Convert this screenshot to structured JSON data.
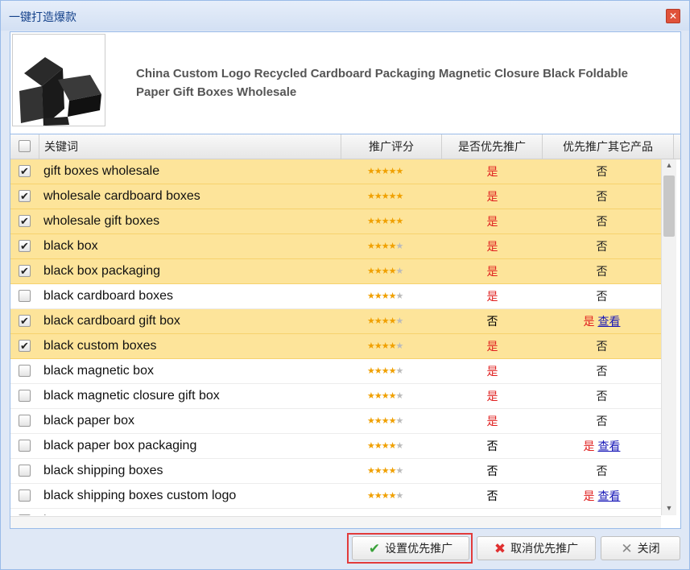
{
  "window": {
    "title": "一键打造爆款",
    "close_icon": "close-icon"
  },
  "product": {
    "title": "China Custom Logo Recycled Cardboard Packaging Magnetic Closure Black Foldable Paper Gift Boxes Wholesale"
  },
  "table": {
    "headers": {
      "keyword": "关键词",
      "rating": "推广评分",
      "priority": "是否优先推广",
      "other": "优先推广其它产品"
    },
    "rows": [
      {
        "keyword": "gift boxes wholesale",
        "checked": true,
        "rating": 5,
        "priority": "是",
        "other": "否",
        "other_link": ""
      },
      {
        "keyword": "wholesale cardboard boxes",
        "checked": true,
        "rating": 5,
        "priority": "是",
        "other": "否",
        "other_link": ""
      },
      {
        "keyword": "wholesale gift boxes",
        "checked": true,
        "rating": 5,
        "priority": "是",
        "other": "否",
        "other_link": ""
      },
      {
        "keyword": "black box",
        "checked": true,
        "rating": 4,
        "priority": "是",
        "other": "否",
        "other_link": ""
      },
      {
        "keyword": "black box packaging",
        "checked": true,
        "rating": 4,
        "priority": "是",
        "other": "否",
        "other_link": ""
      },
      {
        "keyword": "black cardboard boxes",
        "checked": false,
        "rating": 4,
        "priority": "是",
        "other": "否",
        "other_link": ""
      },
      {
        "keyword": "black cardboard gift box",
        "checked": true,
        "rating": 4,
        "priority": "否",
        "other": "是",
        "other_link": "查看"
      },
      {
        "keyword": "black custom boxes",
        "checked": true,
        "rating": 4,
        "priority": "是",
        "other": "否",
        "other_link": ""
      },
      {
        "keyword": "black magnetic box",
        "checked": false,
        "rating": 4,
        "priority": "是",
        "other": "否",
        "other_link": ""
      },
      {
        "keyword": "black magnetic closure gift box",
        "checked": false,
        "rating": 4,
        "priority": "是",
        "other": "否",
        "other_link": ""
      },
      {
        "keyword": "black paper box",
        "checked": false,
        "rating": 4,
        "priority": "是",
        "other": "否",
        "other_link": ""
      },
      {
        "keyword": "black paper box packaging",
        "checked": false,
        "rating": 4,
        "priority": "否",
        "other": "是",
        "other_link": "查看"
      },
      {
        "keyword": "black shipping boxes",
        "checked": false,
        "rating": 4,
        "priority": "否",
        "other": "否",
        "other_link": ""
      },
      {
        "keyword": "black shipping boxes custom logo",
        "checked": false,
        "rating": 4,
        "priority": "否",
        "other": "是",
        "other_link": "查看"
      },
      {
        "keyword": "b",
        "checked": false,
        "rating": 4,
        "priority": "是",
        "other": "否",
        "other_link": ""
      }
    ]
  },
  "buttons": {
    "set_priority": "设置优先推广",
    "cancel_priority": "取消优先推广",
    "close": "关闭"
  },
  "colors": {
    "selected_row": "#fde49a",
    "yes_red": "#e02020",
    "star": "#f0a000",
    "highlight": "#e23b3b"
  }
}
